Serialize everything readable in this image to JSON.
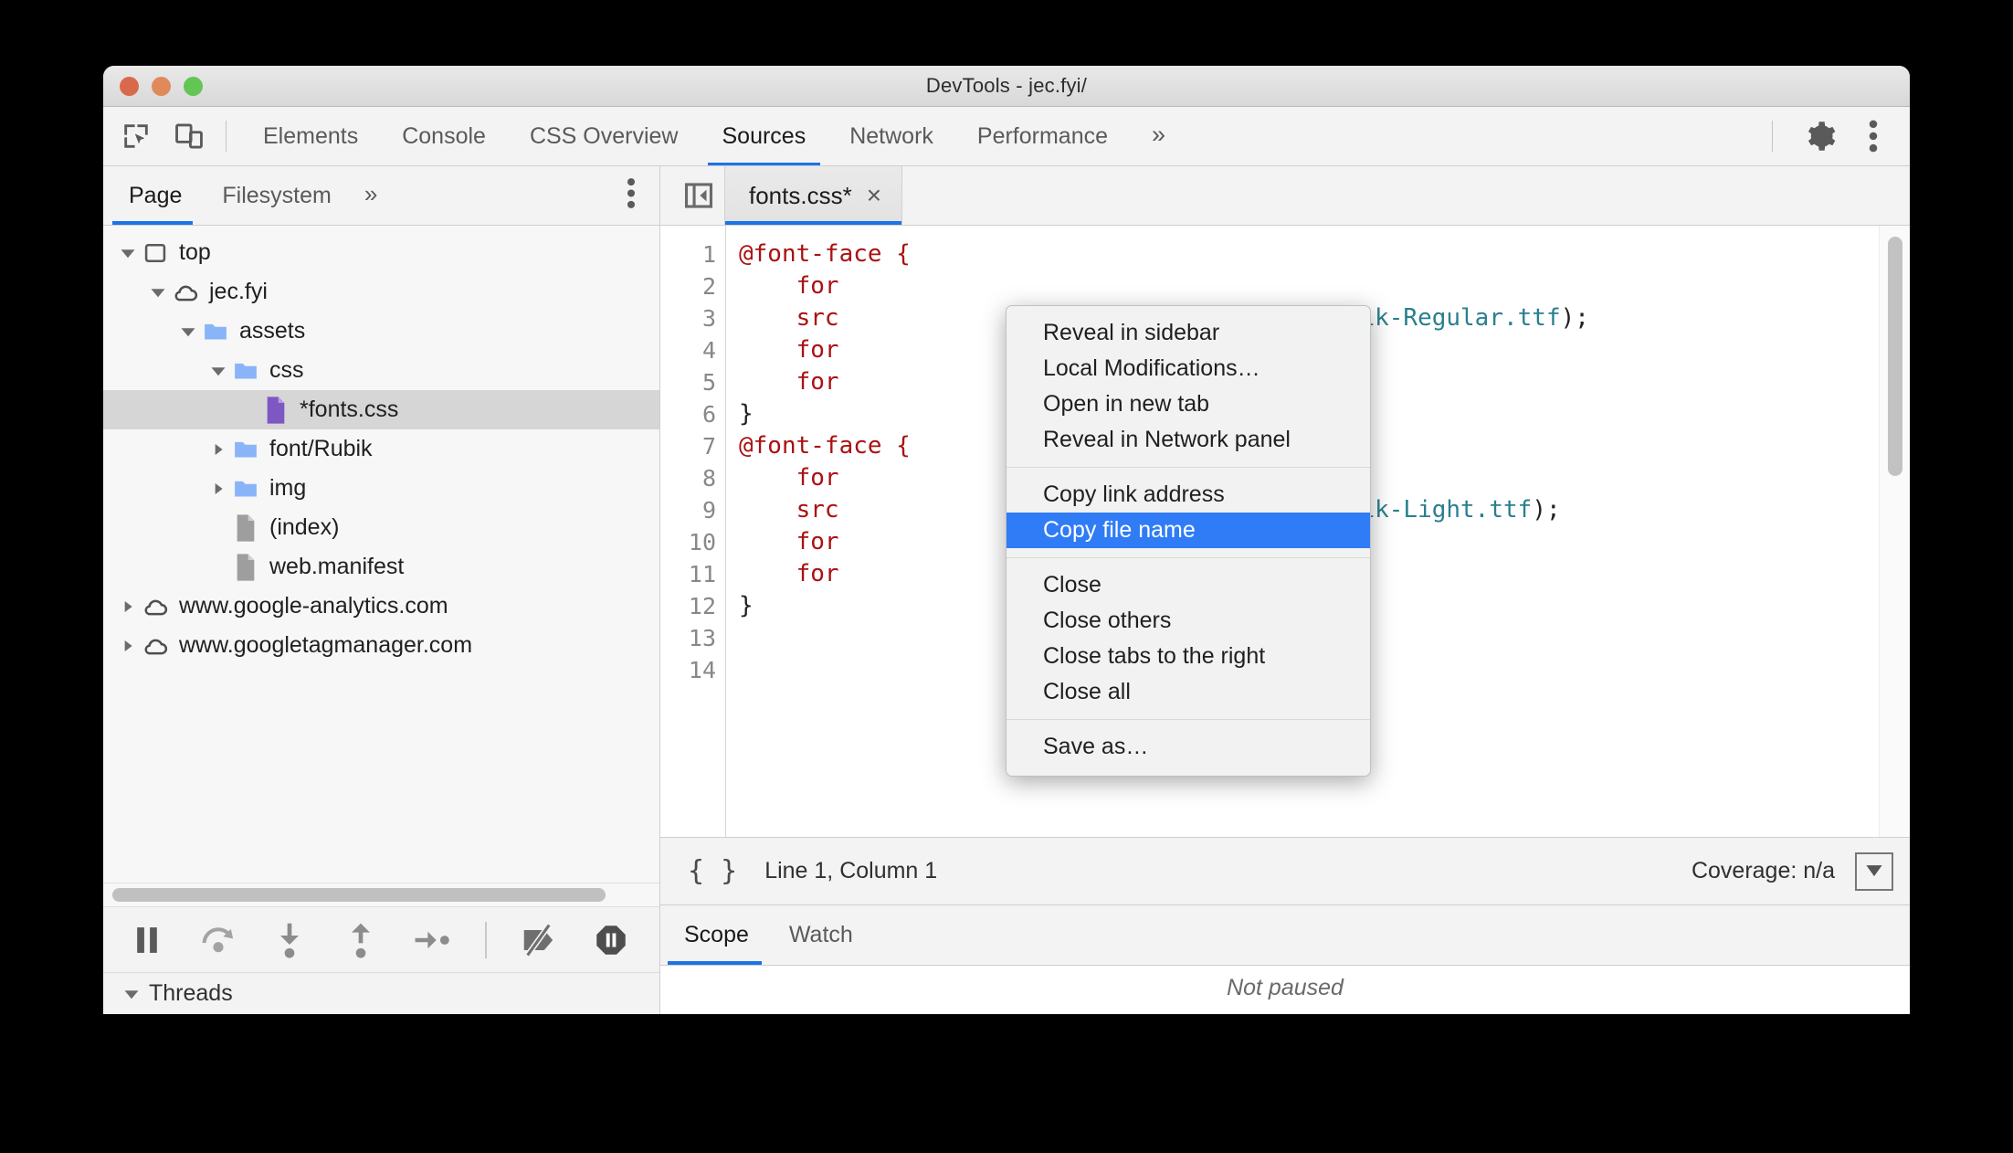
{
  "window": {
    "title": "DevTools - jec.fyi/",
    "traffic_lights": [
      "close",
      "minimize",
      "zoom"
    ]
  },
  "main_toolbar": {
    "inspect_icon": "inspect-element-icon",
    "device_icon": "device-toolbar-icon",
    "tabs": [
      {
        "label": "Elements",
        "active": false
      },
      {
        "label": "Console",
        "active": false
      },
      {
        "label": "CSS Overview",
        "active": false
      },
      {
        "label": "Sources",
        "active": true
      },
      {
        "label": "Network",
        "active": false
      },
      {
        "label": "Performance",
        "active": false
      }
    ],
    "more_tabs": "»",
    "settings_icon": "gear-icon",
    "kebab_icon": "more-options-icon"
  },
  "navigator": {
    "tabs": [
      {
        "label": "Page",
        "active": true
      },
      {
        "label": "Filesystem",
        "active": false
      }
    ],
    "more_tabs": "»",
    "kebab_icon": "more-options-icon",
    "tree": [
      {
        "label": "top",
        "icon": "frame-icon",
        "indent": 0,
        "twisty": "down",
        "selected": false
      },
      {
        "label": "jec.fyi",
        "icon": "cloud-icon",
        "indent": 1,
        "twisty": "down",
        "selected": false
      },
      {
        "label": "assets",
        "icon": "folder-icon",
        "indent": 2,
        "twisty": "down",
        "selected": false
      },
      {
        "label": "css",
        "icon": "folder-icon",
        "indent": 3,
        "twisty": "down",
        "selected": false
      },
      {
        "label": "*fonts.css",
        "icon": "css-file-icon",
        "indent": 4,
        "twisty": "none",
        "selected": true
      },
      {
        "label": "font/Rubik",
        "icon": "folder-icon",
        "indent": 3,
        "twisty": "right",
        "selected": false
      },
      {
        "label": "img",
        "icon": "folder-icon",
        "indent": 3,
        "twisty": "right",
        "selected": false
      },
      {
        "label": "(index)",
        "icon": "doc-icon",
        "indent": 3,
        "twisty": "none",
        "selected": false
      },
      {
        "label": "web.manifest",
        "icon": "doc-icon",
        "indent": 3,
        "twisty": "none",
        "selected": false
      },
      {
        "label": "www.google-analytics.com",
        "icon": "cloud-icon",
        "indent": 1,
        "twisty": "right",
        "selected": false
      },
      {
        "label": "www.googletagmanager.com",
        "icon": "cloud-icon",
        "indent": 1,
        "twisty": "right",
        "selected": false
      }
    ]
  },
  "debugger_toolbar": {
    "buttons": [
      {
        "name": "pause-script-execution-icon"
      },
      {
        "name": "step-over-icon"
      },
      {
        "name": "step-into-icon"
      },
      {
        "name": "step-out-icon"
      },
      {
        "name": "step-icon"
      },
      {
        "name": "deactivate-breakpoints-icon"
      },
      {
        "name": "pause-on-exceptions-icon"
      }
    ],
    "threads_label": "Threads"
  },
  "editor": {
    "collapse_icon": "collapse-sidebar-icon",
    "tab": {
      "label": "fonts.css*",
      "close": "×",
      "dirty": true
    },
    "line_numbers": [
      "1",
      "2",
      "3",
      "4",
      "5",
      "6",
      "7",
      "8",
      "9",
      "10",
      "11",
      "12",
      "13",
      "14"
    ],
    "lines": [
      {
        "segments": [
          {
            "t": "@font-face {",
            "c": "at"
          }
        ]
      },
      {
        "segments": [
          {
            "t": "    for",
            "c": "prop"
          }
        ]
      },
      {
        "segments": [
          {
            "t": "    src",
            "c": "prop"
          },
          {
            "t": "Rubik/Rubik-Regular.ttf",
            "c": "str"
          },
          {
            "t": ");",
            "c": "pun"
          }
        ]
      },
      {
        "segments": [
          {
            "t": "    for",
            "c": "prop"
          }
        ]
      },
      {
        "segments": [
          {
            "t": "    for",
            "c": "prop"
          }
        ]
      },
      {
        "segments": [
          {
            "t": "}",
            "c": "pun"
          }
        ]
      },
      {
        "segments": [
          {
            "t": "",
            "c": "pun"
          }
        ]
      },
      {
        "segments": [
          {
            "t": "@font-face {",
            "c": "at"
          }
        ]
      },
      {
        "segments": [
          {
            "t": "    for",
            "c": "prop"
          }
        ]
      },
      {
        "segments": [
          {
            "t": "    src",
            "c": "prop"
          },
          {
            "t": "Rubik/Rubik-Light.ttf",
            "c": "str"
          },
          {
            "t": ");",
            "c": "pun"
          }
        ]
      },
      {
        "segments": [
          {
            "t": "    for",
            "c": "prop"
          }
        ]
      },
      {
        "segments": [
          {
            "t": "    for",
            "c": "prop"
          }
        ]
      },
      {
        "segments": [
          {
            "t": "}",
            "c": "pun"
          }
        ]
      },
      {
        "segments": [
          {
            "t": "",
            "c": "pun"
          }
        ]
      }
    ],
    "status": {
      "pretty_print": "{ }",
      "cursor_position": "Line 1, Column 1",
      "coverage": "Coverage: n/a",
      "popout_icon": "popout-drawer-icon"
    }
  },
  "lower_pane": {
    "tabs": [
      {
        "label": "Scope",
        "active": true
      },
      {
        "label": "Watch",
        "active": false
      }
    ],
    "not_paused": "Not paused"
  },
  "context_menu": {
    "groups": [
      {
        "items": [
          {
            "label": "Reveal in sidebar",
            "highlight": false
          },
          {
            "label": "Local Modifications…",
            "highlight": false
          },
          {
            "label": "Open in new tab",
            "highlight": false
          },
          {
            "label": "Reveal in Network panel",
            "highlight": false
          }
        ]
      },
      {
        "items": [
          {
            "label": "Copy link address",
            "highlight": false
          },
          {
            "label": "Copy file name",
            "highlight": true
          }
        ]
      },
      {
        "items": [
          {
            "label": "Close",
            "highlight": false
          },
          {
            "label": "Close others",
            "highlight": false
          },
          {
            "label": "Close tabs to the right",
            "highlight": false
          },
          {
            "label": "Close all",
            "highlight": false
          }
        ]
      },
      {
        "items": [
          {
            "label": "Save as…",
            "highlight": false
          }
        ]
      }
    ]
  },
  "colors": {
    "accent": "#1a73e8",
    "menu_highlight": "#2f7cf6",
    "css_token_at": "#aa1111",
    "css_token_string": "#2a7f8f",
    "folder": "#8ab4f8",
    "css_file": "#7e57c2"
  }
}
